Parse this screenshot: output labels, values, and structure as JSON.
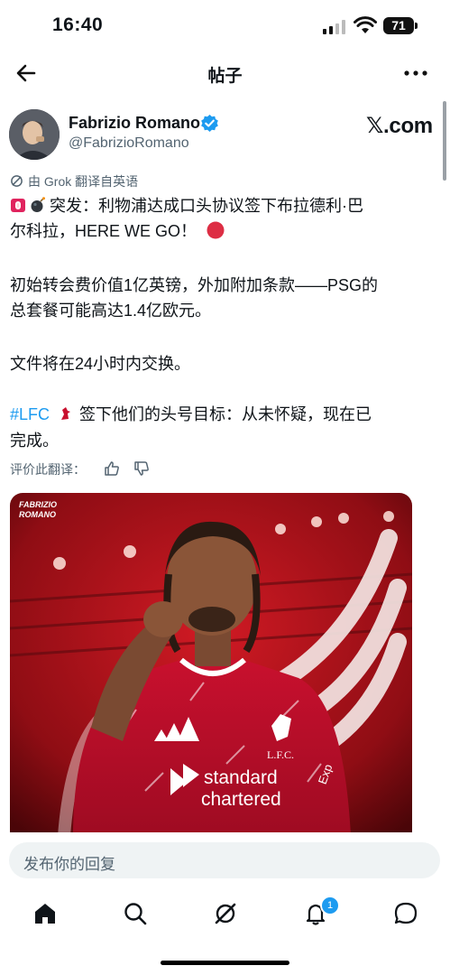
{
  "status_bar": {
    "time": "16:40",
    "battery": "71"
  },
  "nav": {
    "title": "帖子"
  },
  "author": {
    "name": "Fabrizio Romano",
    "handle": "@FabrizioRomano",
    "site_logo": "𝕏.com"
  },
  "translation_note": "由 Grok 翻译自英语",
  "tweet": {
    "line1": "突发：利物浦达成口头协议签下布拉德利·巴",
    "line2": "尔科拉，HERE WE GO！",
    "line3": "初始转会费价值1亿英镑，外加附加条款——PSG的",
    "line4": "总套餐可能高达1.4亿欧元。",
    "line5": "文件将在24小时内交换。",
    "hashtag": "#LFC",
    "line6_text": "签下他们的头号目标：从未怀疑，现在已",
    "line7": "完成。"
  },
  "rate_translation_label": "评价此翻译：",
  "photo": {
    "watermark_line1": "FABRIZIO",
    "watermark_line2": "ROMANO",
    "crest_text": "L.F.C.",
    "sponsor_line1": "standard",
    "sponsor_line2": "chartered",
    "sleeve_text": "Exp"
  },
  "reply": {
    "placeholder": "发布你的回复"
  },
  "tabs": {
    "notifications_badge": "1"
  },
  "colors": {
    "accent": "#1d9bf0",
    "kit_red": "#c8102e",
    "secondary_text": "#536471"
  },
  "icons": [
    "back-icon",
    "more-icon",
    "verified-icon",
    "grok-icon",
    "thumb-up-icon",
    "thumb-down-icon",
    "home-icon",
    "search-icon",
    "grok-tab-icon",
    "bell-icon",
    "message-icon",
    "siren-emoji",
    "bomb-emoji",
    "red-circle-emoji",
    "liverbird-emoji"
  ]
}
